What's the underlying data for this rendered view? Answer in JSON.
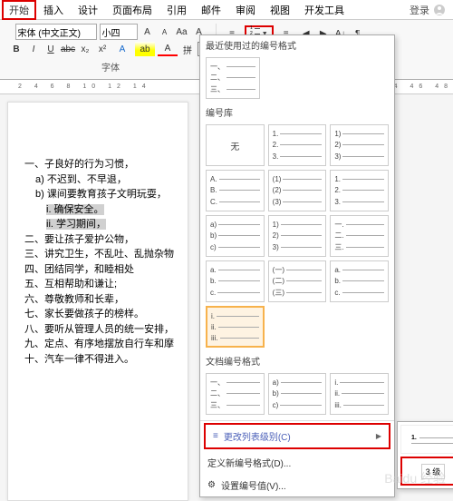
{
  "menu": {
    "start": "开始",
    "insert": "插入",
    "design": "设计",
    "page_layout": "页面布局",
    "references": "引用",
    "mail": "邮件",
    "review": "审阅",
    "view": "视图",
    "dev_tools": "开发工具",
    "login": "登录"
  },
  "ribbon": {
    "font_name": "宋体 (中文正文)",
    "font_size": "小四",
    "font_group_label": "字体"
  },
  "ruler": "2  4  6  8  10  12  14",
  "ruler_right": "34 36 38 40 42 44 46 48",
  "document": {
    "l1": "一、子良好的行为习惯，",
    "l2": "a) 不迟到、不早退，",
    "l3": "b) 课间要教育孩子文明玩耍，",
    "l4": "i.   确保安全。",
    "l5": "ii.  学习期间，",
    "l6": "二、要让孩子爱护公物，",
    "l7": "三、讲究卫生，不乱吐、乱抛杂物",
    "l8": "四、团结同学，和睦相处",
    "l9": "五、互相帮助和谦让;",
    "l10": "六、尊敬教师和长辈，",
    "l11": "七、家长要做孩子的榜样。",
    "l12": "八、要听从管理人员的统一安排，",
    "l13": "九、定点、有序地摆放自行车和摩",
    "l14": "十、汽车一律不得进入。"
  },
  "dropdown": {
    "recent_title": "最近使用过的编号格式",
    "library_title": "编号库",
    "doc_format_title": "文档编号格式",
    "none_label": "无",
    "change_level": "更改列表级别(C)",
    "define_new": "定义新编号格式(D)...",
    "set_value": "设置编号值(V)...",
    "recent_a": [
      "一、",
      "二、",
      "三、"
    ],
    "lib_b": [
      "1.",
      "2.",
      "3."
    ],
    "lib_c": [
      "1)",
      "2)",
      "3)"
    ],
    "lib_d": [
      "A.",
      "B.",
      "C."
    ],
    "lib_e": [
      "(1)",
      "(2)",
      "(3)"
    ],
    "lib_e2": [
      "1.",
      "2.",
      "3."
    ],
    "lib_f": [
      "a)",
      "b)",
      "c)"
    ],
    "lib_g": [
      "1)",
      "2)",
      "3)"
    ],
    "lib_h": [
      "一.",
      "二.",
      "三."
    ],
    "lib_i": [
      "a.",
      "b.",
      "c."
    ],
    "lib_j": [
      "(一)",
      "(二)",
      "(三)"
    ],
    "lib_k": [
      "a.",
      "b.",
      "c."
    ],
    "lib_l": [
      "i.",
      "ii.",
      "iii."
    ],
    "doc_a": [
      "一、",
      "二、",
      "三、"
    ],
    "doc_b": [
      "a)",
      "b)",
      "c)"
    ],
    "doc_c": [
      "i.",
      "ii.",
      "iii."
    ]
  },
  "submenu": {
    "level1": "1.",
    "hint": "3 级"
  }
}
